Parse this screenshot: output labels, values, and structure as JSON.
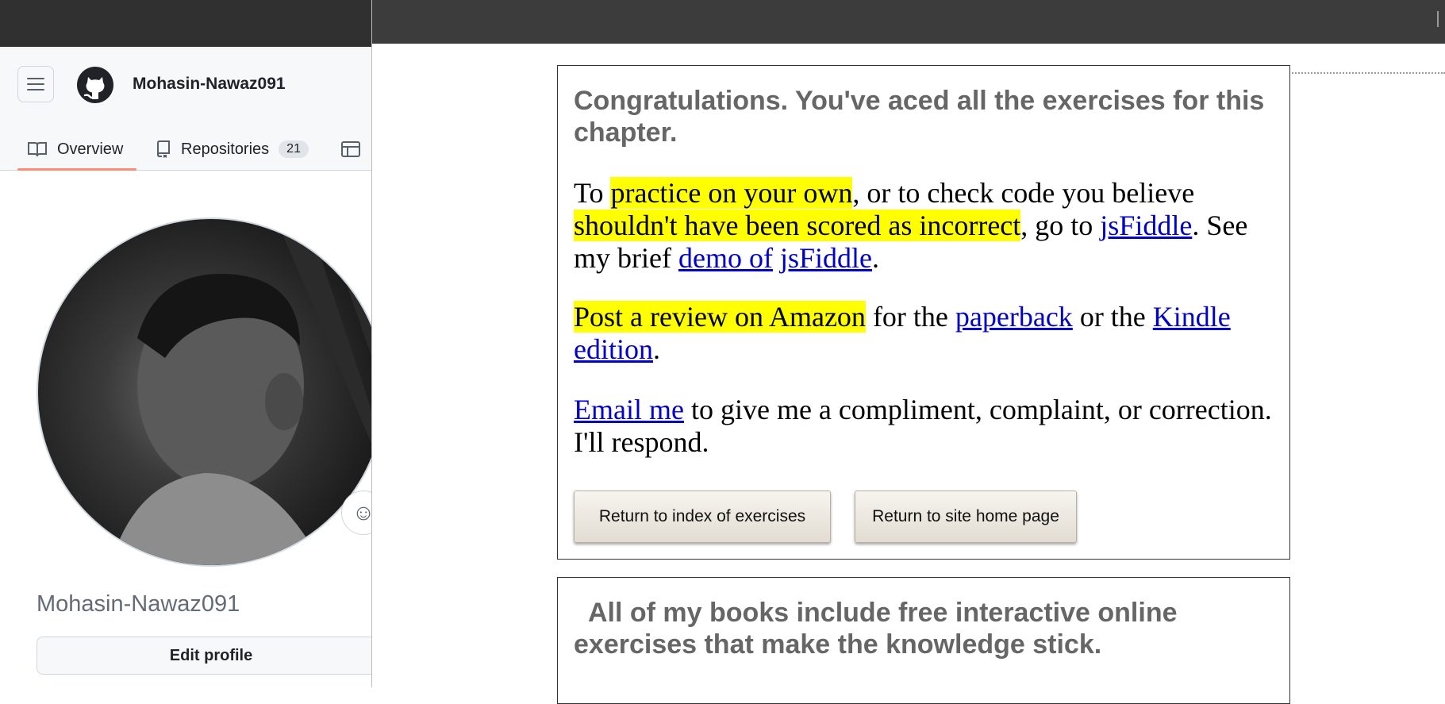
{
  "github": {
    "username": "Mohasin-Nawaz091",
    "tabs": {
      "overview_label": "Overview",
      "repositories_label": "Repositories",
      "repositories_count": "21"
    },
    "display_name": "Mohasin-Nawaz091",
    "edit_profile_label": "Edit profile",
    "icons": [
      "hamburger-menu-icon",
      "github-logo-icon",
      "book-icon",
      "repo-icon",
      "table-icon",
      "smiley-icon"
    ]
  },
  "exercise_page": {
    "congrats_title": "Congratulations. You've aced all the exercises for this chapter.",
    "para1": {
      "t1": "To ",
      "h1": "practice on your own",
      "t2": ", or to check code you believe ",
      "h2": "shouldn't have been scored as incorrect",
      "t3": ", go to ",
      "link1": "jsFiddle",
      "t4": ". See my brief ",
      "link2a": "demo of",
      "link2b": "jsFiddle",
      "t5": "."
    },
    "para2": {
      "h1": "Post a review on Amazon",
      "t1": " for the ",
      "link1": "paperback",
      "t2": " or the ",
      "link2": "Kindle edition",
      "t3": "."
    },
    "para3": {
      "link1": "Email me",
      "t1": " to give me a compliment, complaint, or correction. I'll respond."
    },
    "buttons": {
      "index_label": "Return to index of exercises",
      "home_label": "Return to site home page"
    },
    "books_title": "All of my books include free interactive online exercises that make the knowledge stick."
  },
  "colors": {
    "highlight": "#ffff00",
    "link": "#0000cc",
    "heading_gray": "#666666",
    "topbar_dark": "#3c3c3c",
    "tab_underline": "#fd8c73"
  }
}
